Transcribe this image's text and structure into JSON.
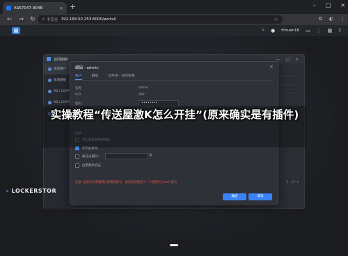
{
  "browser": {
    "tab_title": "ASK7047-904B",
    "new_tab_glyph": "+",
    "window_controls": [
      "–",
      "□",
      "×"
    ],
    "security_label": "不安全",
    "url": "192.168.50.253:6000/portal/",
    "icons": [
      "back-icon",
      "forward-icon",
      "reload-icon",
      "star-icon",
      "extensions-icon",
      "profile-icon",
      "menu-icon"
    ]
  },
  "portal": {
    "user": "fchuan16",
    "icons": [
      "search-icon",
      "user-icon",
      "chat-icon",
      "options-icon",
      "grid-icon",
      "help-icon"
    ]
  },
  "app": {
    "title": "访问控制",
    "sidebar": [
      {
        "label": "本地用户"
      },
      {
        "label": "本地群组"
      },
      {
        "label": "AD / LDAP"
      },
      {
        "label": "AD / LDAP"
      },
      {
        "label": "应用权限"
      }
    ],
    "pager": "1 - 3 / 3"
  },
  "dialog": {
    "title": "编辑 - admin",
    "tabs": [
      "账户",
      "群组",
      "文件夹 - 访问权限"
    ],
    "fields": {
      "name_label": "名称",
      "name_value": "admin",
      "uid_label": "UID",
      "uid_value": "999",
      "password_label": "密码",
      "password_value": "••••••••"
    },
    "options_label": "选项",
    "checkboxes": [
      {
        "label": "禁止此账号修改密码",
        "checked": false
      },
      {
        "label": "停用此账号",
        "checked": true
      },
      {
        "label": "账号过期日：",
        "checked": false
      },
      {
        "label": "启用两步验证",
        "checked": false
      }
    ],
    "note": "注意: 此账号为系统默认管理员账号，建议您保留至少一个管理员 (root) 账号",
    "ok_label": "确定",
    "cancel_label": "取消",
    "close_glyph": "×"
  },
  "headline": "实操教程“传送屋激K怎么开挂”(原来确实是有插件)",
  "brand": {
    "mark": "⌁",
    "name": "LOCKERSTOR"
  },
  "colors": {
    "accent": "#3b82f6",
    "warning": "#e0574b",
    "background": "#16181c"
  }
}
